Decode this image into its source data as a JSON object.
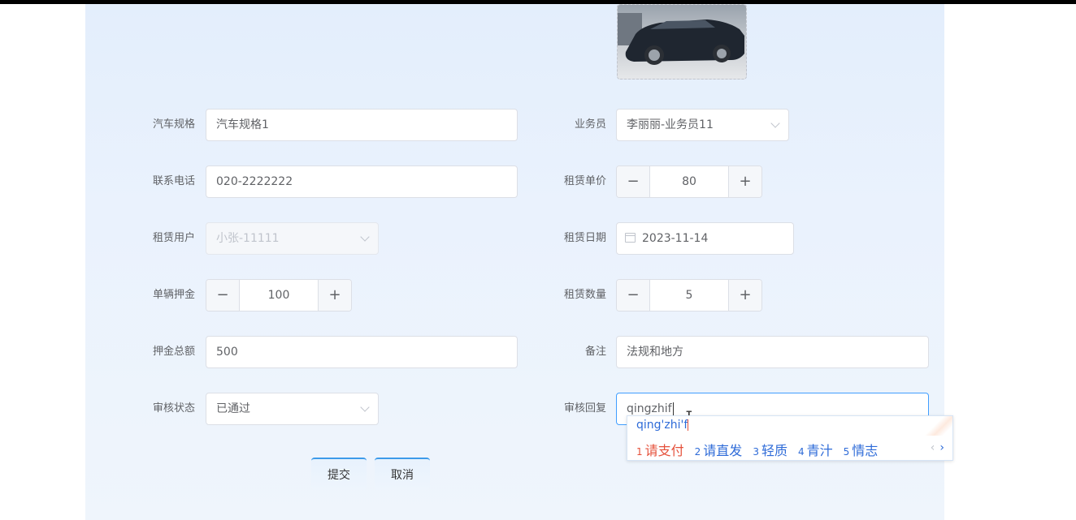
{
  "form": {
    "spec": {
      "label": "汽车规格",
      "value": "汽车规格1"
    },
    "salesman": {
      "label": "业务员",
      "value": "李丽丽-业务员11"
    },
    "phone": {
      "label": "联系电话",
      "value": "020-2222222"
    },
    "unit_price": {
      "label": "租赁单价",
      "value": "80",
      "dec": "−",
      "inc": "+"
    },
    "rent_user": {
      "label": "租赁用户",
      "value": "小张-11111"
    },
    "rent_date": {
      "label": "租赁日期",
      "value": "2023-11-14"
    },
    "deposit": {
      "label": "单辆押金",
      "value": "100",
      "dec": "−",
      "inc": "+"
    },
    "quantity": {
      "label": "租赁数量",
      "value": "5",
      "dec": "−",
      "inc": "+"
    },
    "deposit_total": {
      "label": "押金总额",
      "value": "500"
    },
    "remark": {
      "label": "备注",
      "value": "法规和地方"
    },
    "audit_status": {
      "label": "审核状态",
      "value": "已通过"
    },
    "audit_reply": {
      "label": "审核回复",
      "value": "qingzhif"
    }
  },
  "ime": {
    "composition": "qing'zhi'f",
    "candidates": [
      {
        "num": "1",
        "text": "请支付"
      },
      {
        "num": "2",
        "text": "请直发"
      },
      {
        "num": "3",
        "text": "轻质"
      },
      {
        "num": "4",
        "text": "青汁"
      },
      {
        "num": "5",
        "text": "情志"
      }
    ],
    "prev": "‹",
    "next": "›"
  },
  "buttons": {
    "submit": "提交",
    "cancel": "取消"
  },
  "colors": {
    "primary": "#409eff",
    "ime_highlight": "#e5503a",
    "ime_text": "#2e6bd8"
  }
}
